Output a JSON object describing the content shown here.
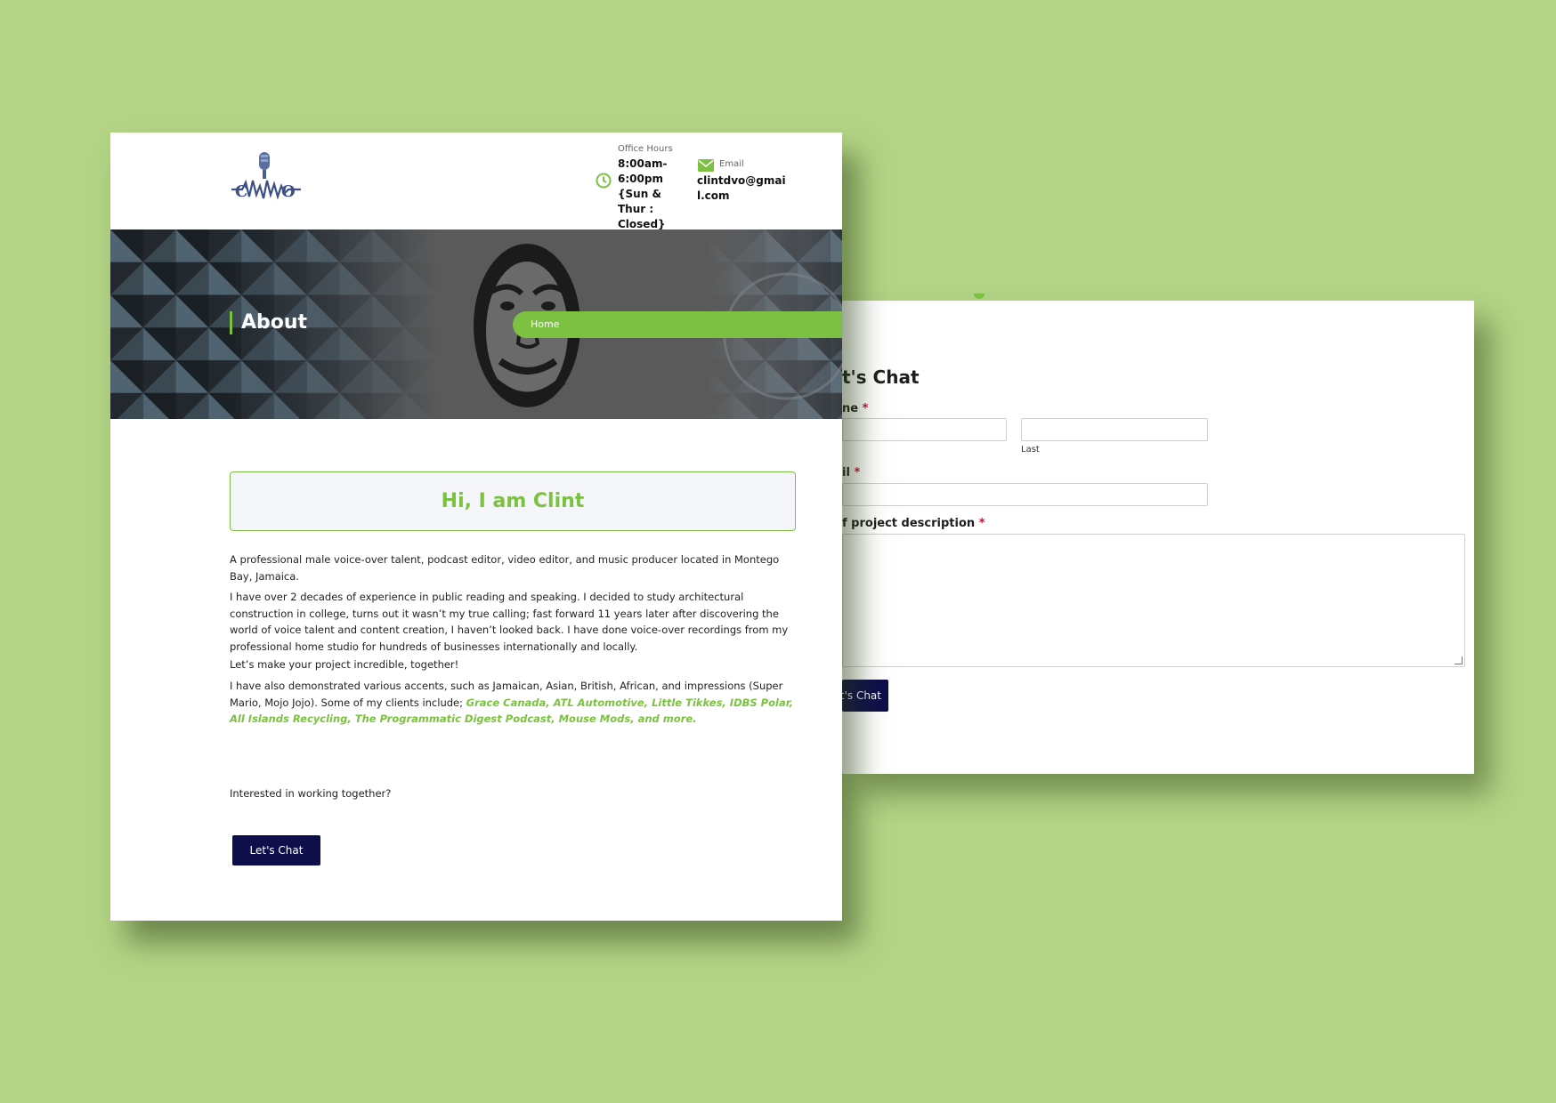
{
  "form": {
    "title": "t's Chat",
    "name_label": "ne",
    "last_sublabel": "Last",
    "email_label": "il",
    "description_label": "f project description",
    "required_mark": "*",
    "submit_label": "t's Chat"
  },
  "header": {
    "office_hours_label": "Office Hours",
    "office_hours_value": "8:00am-6:00pm {Sun & Thur : Closed}",
    "email_label": "Email",
    "email_value": "clintdvo@gmail.com"
  },
  "hero": {
    "title": "About",
    "breadcrumb_home": "Home"
  },
  "content": {
    "greeting": "Hi, I am Clint",
    "para1": "A professional male voice-over talent, podcast editor, video editor, and music producer located in Montego Bay, Jamaica.",
    "para2": "I have over 2 decades of experience in public reading and speaking. I decided to study architectural construction in college, turns out it wasn’t my true calling; fast forward 11 years later after discovering the world of voice talent and content creation, I haven’t looked back. I have done voice-over recordings from my professional home studio for hundreds of businesses internationally and locally.",
    "para3": "Let’s make your project incredible, together!",
    "para4": "I have also demonstrated various accents, such as Jamaican, Asian, British, African, and impressions (Super Mario, Mojo Jojo). Some of my clients include;",
    "clients": "Grace Canada, ATL Automotive, Little Tikkes, IDBS Polar, All Islands Recycling,  The Programmatic Digest Podcast, Mouse Mods, and more.",
    "interested": "Interested in working together?",
    "cta_label": "Let's Chat"
  },
  "colors": {
    "background": "#b3d485",
    "accent_green": "#7cc142",
    "button_navy": "#0e0e4a"
  }
}
